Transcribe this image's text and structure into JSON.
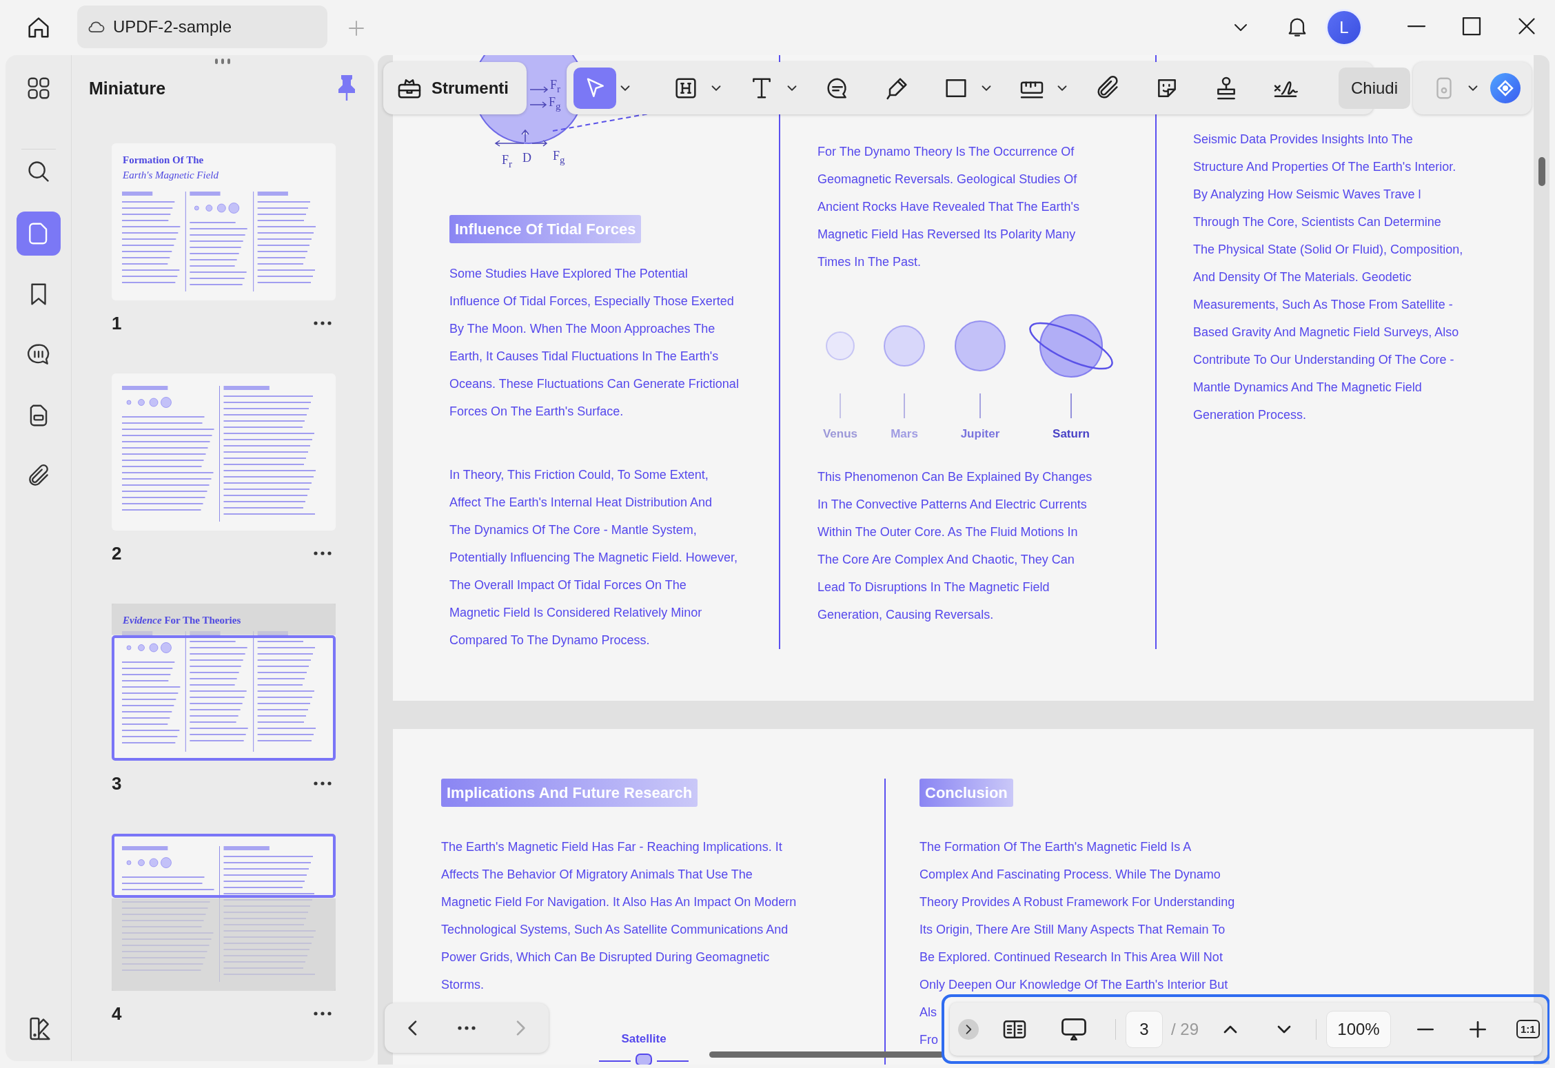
{
  "top_bar": {
    "document_tab": "UPDF-2-sample",
    "avatar_initial": "L"
  },
  "rail": {
    "items": [
      {
        "kind": "grid",
        "selected": false
      },
      {
        "kind": "search",
        "selected": false
      },
      {
        "kind": "pages",
        "selected": true
      },
      {
        "kind": "bookmark",
        "selected": false
      },
      {
        "kind": "comment",
        "selected": false
      },
      {
        "kind": "form",
        "selected": false
      },
      {
        "kind": "attachment",
        "selected": false
      }
    ]
  },
  "thumbnails": {
    "title": "Miniature",
    "pinned": true,
    "pages": [
      {
        "number": "1",
        "in_view": false,
        "title_lines": [
          {
            "text": "Formation Of The",
            "italic": false
          },
          {
            "text": "Earth's Magnetic Field",
            "italic": true
          }
        ]
      },
      {
        "number": "2",
        "in_view": false
      },
      {
        "number": "3",
        "in_view": true,
        "title_lines": [
          {
            "text": "*Evidence* For The Theories",
            "italic": false
          }
        ]
      },
      {
        "number": "4",
        "in_view": true
      }
    ]
  },
  "toolbar": {
    "tools_button": "Strumenti",
    "tools": [
      {
        "kind": "select",
        "selected": true,
        "menu": true
      },
      {
        "kind": "textbox",
        "selected": false,
        "menu": true
      },
      {
        "kind": "text",
        "selected": false,
        "menu": true
      },
      {
        "kind": "comment",
        "selected": false,
        "menu": false
      },
      {
        "kind": "pen",
        "selected": false,
        "menu": false
      },
      {
        "kind": "rectangle",
        "selected": false,
        "menu": true
      },
      {
        "kind": "measure",
        "selected": false,
        "menu": true
      },
      {
        "kind": "attachment",
        "selected": false,
        "menu": false
      },
      {
        "kind": "sticker",
        "selected": false,
        "menu": false
      },
      {
        "kind": "stamp",
        "selected": false,
        "menu": false
      },
      {
        "kind": "signature",
        "selected": false,
        "menu": false
      }
    ],
    "close_button": "Chiudi",
    "save_disabled": true
  },
  "document": {
    "pages": [
      {
        "columns": [
          {
            "blocks": [
              {
                "kind": "figure",
                "labels": [
                  "F$_{r}$",
                  "F$_{g}$",
                  "F$_{r}$",
                  "D",
                  "F$_{g}$"
                ]
              },
              {
                "kind": "heading",
                "text": "Influence Of Tidal Forces"
              },
              {
                "kind": "paragraph",
                "lines": [
                  "Some Studies Have Explored The Potential",
                  "Influence Of Tidal Forces, Especially Those Exerted",
                  "By The Moon. When The Moon Approaches The",
                  "Earth, It Causes Tidal Fluctuations In The Earth's",
                  "Oceans. These Fluctuations Can Generate Frictional",
                  "Forces On The Earth's Surface."
                ]
              },
              {
                "kind": "paragraph",
                "lines": [
                  "In Theory, This Friction Could, To Some Extent,",
                  "Affect The Earth's Internal Heat Distribution And",
                  "The Dynamics Of The Core - Mantle System,",
                  "Potentially Influencing The Magnetic Field. However,",
                  "The Overall Impact Of Tidal Forces On The",
                  "Magnetic Field Is Considered Relatively Minor",
                  "Compared To The Dynamo Process."
                ]
              }
            ]
          },
          {
            "blocks": [
              {
                "kind": "paragraph",
                "lines": [
                  "For The Dynamo Theory Is The Occurrence Of",
                  "Geomagnetic Reversals. Geological Studies Of",
                  "Ancient Rocks Have Revealed That The Earth's",
                  "Magnetic Field Has Reversed Its Polarity Many",
                  "Times In The Past."
                ]
              },
              {
                "kind": "planets",
                "planets": [
                  {
                    "name": "Venus",
                    "color": "#e9e8fb",
                    "ringed": false
                  },
                  {
                    "name": "Mars",
                    "color": "#d8d7fa",
                    "ringed": false
                  },
                  {
                    "name": "Jupiter",
                    "color": "#c3c1f8",
                    "ringed": false
                  },
                  {
                    "name": "Saturn",
                    "color": "#b1aef6",
                    "ringed": true
                  }
                ]
              },
              {
                "kind": "paragraph",
                "lines": [
                  "This Phenomenon Can Be Explained By Changes",
                  "In The Convective Patterns And Electric Currents",
                  "Within The Outer Core. As The Fluid Motions In",
                  "The Core Are Complex And Chaotic, They Can",
                  "Lead To Disruptions In The Magnetic Field",
                  "Generation, Causing Reversals."
                ]
              }
            ]
          },
          {
            "blocks": [
              {
                "kind": "paragraph",
                "lines": [
                  "Seismic Data Provides Insights Into The",
                  "Structure And Properties Of The Earth's Interior.",
                  "By Analyzing How Seismic Waves Trave l",
                  "Through The Core, Scientists Can Determine",
                  "The Physical State (Solid Or Fluid), Composition,",
                  "And Density Of The Materials. Geodetic",
                  "Measurements, Such As Those From Satellite -",
                  "Based Gravity And Magnetic Field Surveys, Also",
                  "Contribute To Our Understanding Of The Core -",
                  "Mantle Dynamics And The Magnetic Field",
                  "Generation Process."
                ]
              }
            ]
          }
        ]
      },
      {
        "columns": [
          {
            "blocks": [
              {
                "kind": "heading",
                "text": "Implications And Future Research"
              },
              {
                "kind": "paragraph",
                "lines": [
                  "The Earth's Magnetic Field Has Far - Reaching Implications. It",
                  "Affects The Behavior Of Migratory Animals That Use The",
                  "Magnetic Field For Navigation. It Also Has An Impact On Modern",
                  "Technological Systems, Such As Satellite Communications And",
                  "Power Grids, Which Can Be Disrupted During Geomagnetic",
                  "Storms."
                ]
              },
              {
                "kind": "caption",
                "text": "Satellite"
              }
            ]
          },
          {
            "blocks": [
              {
                "kind": "heading",
                "text": "Conclusion"
              },
              {
                "kind": "paragraph",
                "lines": [
                  "The Formation Of The Earth's Magnetic Field Is A",
                  "Complex And Fascinating Process. While The Dynamo",
                  "Theory Provides A Robust Framework For Understanding",
                  "Its Origin, There Are Still Many Aspects That Remain To",
                  "Be Explored. Continued Research In This Area Will Not",
                  "Only Deepen Our Knowledge Of The Earth's Interior But"
                ]
              },
              {
                "kind": "fragment",
                "lines": [
                  "Als",
                  "Fro"
                ]
              }
            ]
          }
        ]
      }
    ]
  },
  "navigation": {
    "next_disabled": true
  },
  "page_bar": {
    "current_page": "3",
    "page_total": "/ 29",
    "zoom": "100%",
    "actual_size": "1:1"
  }
}
